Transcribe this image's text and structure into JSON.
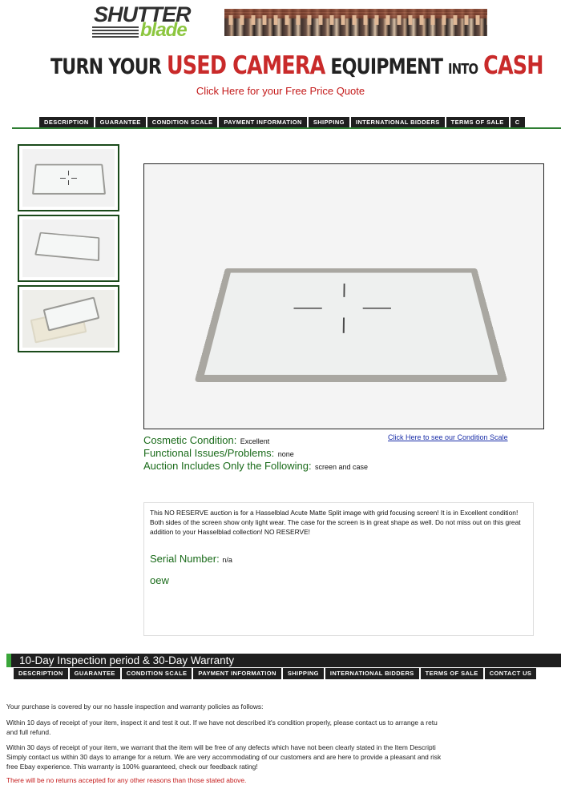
{
  "header": {
    "logo_top": "SHUTTER",
    "logo_bottom": "blade",
    "banner": [
      "TURN YOUR",
      "USED CAMERA",
      "EQUIPMENT",
      "INTO",
      "CASH"
    ],
    "quote_link": "Click Here for your Free Price Quote"
  },
  "nav_top": [
    "DESCRIPTION",
    "GUARANTEE",
    "CONDITION SCALE",
    "PAYMENT INFORMATION",
    "SHIPPING",
    "INTERNATIONAL BIDDERS",
    "TERMS OF SALE",
    "C"
  ],
  "condition": {
    "cosmetic_label": "Cosmetic Condition:",
    "cosmetic_value": "Excellent",
    "functional_label": "Functional Issues/Problems:",
    "functional_value": "none",
    "includes_label": "Auction Includes Only the Following:",
    "includes_value": "screen and case",
    "scale_link": "Click Here to see our Condition Scale"
  },
  "description": {
    "text": "This NO RESERVE auction is for a Hasselblad Acute Matte Split image with grid focusing screen! It is in Excellent condition! Both sides of the screen show only light wear. The case for the screen is in great shape as well. Do not miss out on this great addition to your Hasselblad collection! NO RESERVE!",
    "serial_label": "Serial Number:",
    "serial_value": "n/a",
    "code": "oew"
  },
  "warranty": {
    "title": "10-Day Inspection period & 30-Day Warranty",
    "nav": [
      "DESCRIPTION",
      "GUARANTEE",
      "CONDITION SCALE",
      "PAYMENT INFORMATION",
      "SHIPPING",
      "INTERNATIONAL BIDDERS",
      "TERMS OF SALE",
      "CONTACT US"
    ],
    "p1": "Your purchase is covered by our no hassle inspection and warranty policies as follows:",
    "p2_line1": "Within 10 days of receipt of your item, inspect it and test it out. If we have not described it's condition properly, please contact us to arrange a retu",
    "p2_line2": "and full refund.",
    "p3_line1": "Within 30 days of receipt of your item, we warrant that the item will be free of any defects which have not been clearly stated in the Item Descripti",
    "p3_line2": "Simply contact us within 30 days to arrange for a return. We are very accommodating of our customers and are here to provide a pleasant and risk",
    "p3_line3": "free Ebay experience. This warranty is 100% guaranteed, check our feedback rating!",
    "p4": "There will be no returns accepted for any other reasons than those stated above."
  }
}
